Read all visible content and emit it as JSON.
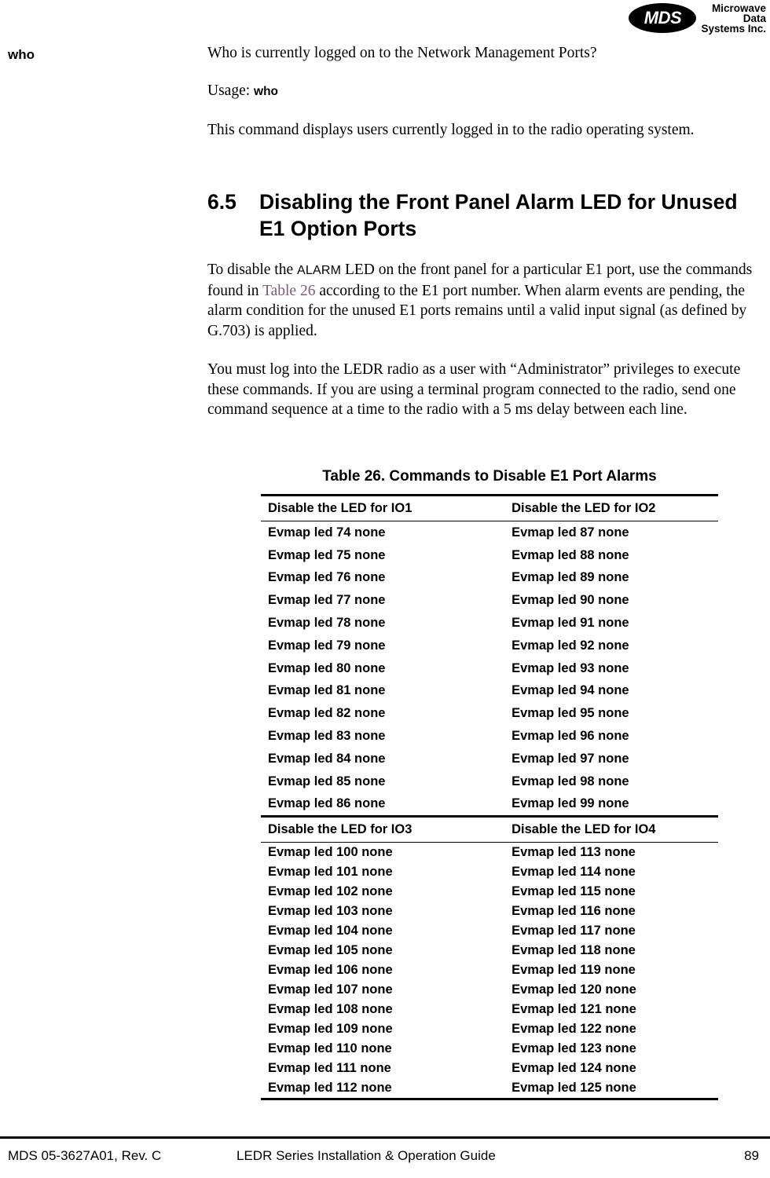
{
  "header": {
    "logo_mark_text": "MDS",
    "logo_words": [
      "Microwave",
      "Data",
      "Systems Inc."
    ]
  },
  "margin_label": "who",
  "body": {
    "intro_question": "Who is currently logged on to the Network Management Ports?",
    "usage_label": "Usage:",
    "usage_command": "who",
    "description": "This command displays users currently logged in to the radio operating system."
  },
  "section": {
    "number": "6.5",
    "title": "Disabling the Front Panel Alarm LED for Unused E1 Option Ports",
    "paragraph1_pre": "To disable the ",
    "paragraph1_term": "ALARM",
    "paragraph1_mid": " LED on the front panel for a particular E1 port, use the commands found in ",
    "paragraph1_link": "Table 26",
    "paragraph1_post": " according to the E1 port number. When alarm events are pending, the alarm condition for the unused E1 ports remains until a valid input signal (as defined by G.703) is applied.",
    "paragraph2": "You must log into the LEDR radio as a user with “Administrator” privileges to execute these commands. If you are using a terminal program connected to the radio, send one command sequence at a time to the radio with a 5 ms delay between each line."
  },
  "table": {
    "caption": "Table 26. Commands to Disable E1 Port Alarms",
    "groups": [
      {
        "headers": [
          "Disable the LED for IO1",
          "Disable the LED for IO2"
        ],
        "rows": [
          [
            "Evmap led 74 none",
            "Evmap led 87 none"
          ],
          [
            "Evmap led 75 none",
            "Evmap led 88 none"
          ],
          [
            "Evmap led 76 none",
            "Evmap led 89 none"
          ],
          [
            "Evmap led 77 none",
            "Evmap led 90 none"
          ],
          [
            "Evmap led 78 none",
            "Evmap led 91 none"
          ],
          [
            "Evmap led 79 none",
            "Evmap led 92 none"
          ],
          [
            "Evmap led 80 none",
            "Evmap led 93 none"
          ],
          [
            "Evmap led 81 none",
            "Evmap led 94 none"
          ],
          [
            "Evmap led 82 none",
            "Evmap led 95 none"
          ],
          [
            "Evmap led 83 none",
            "Evmap led 96 none"
          ],
          [
            "Evmap led 84 none",
            "Evmap led 97 none"
          ],
          [
            "Evmap led 85 none",
            "Evmap led 98 none"
          ],
          [
            "Evmap led 86 none",
            "Evmap led 99 none"
          ]
        ]
      },
      {
        "headers": [
          "Disable the LED for IO3",
          "Disable the LED for IO4"
        ],
        "rows": [
          [
            "Evmap led 100 none",
            "Evmap led 113 none"
          ],
          [
            "Evmap led 101 none",
            "Evmap led 114 none"
          ],
          [
            "Evmap led 102 none",
            "Evmap led 115 none"
          ],
          [
            "Evmap led 103 none",
            "Evmap led 116 none"
          ],
          [
            "Evmap led 104 none",
            "Evmap led 117 none"
          ],
          [
            "Evmap led 105 none",
            "Evmap led 118 none"
          ],
          [
            "Evmap led 106 none",
            "Evmap led 119 none"
          ],
          [
            "Evmap led 107 none",
            "Evmap led 120 none"
          ],
          [
            "Evmap led 108 none",
            "Evmap led 121 none"
          ],
          [
            "Evmap led 109 none",
            "Evmap led 122 none"
          ],
          [
            "Evmap led 110 none",
            "Evmap led 123 none"
          ],
          [
            "Evmap led 111 none",
            "Evmap led 124 none"
          ],
          [
            "Evmap led 112 none",
            "Evmap led 125 none"
          ]
        ]
      }
    ]
  },
  "footer": {
    "left": "MDS 05-3627A01, Rev. C",
    "center": "LEDR Series Installation & Operation Guide",
    "right": "89"
  },
  "colors": {
    "text": "#000000",
    "xref_link": "#7a5c74",
    "rule": "#000000",
    "page_background": "#ffffff"
  }
}
